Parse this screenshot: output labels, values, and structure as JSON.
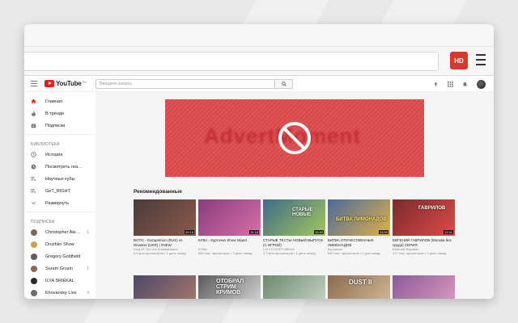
{
  "browser": {
    "url": "",
    "extension_label": "HD"
  },
  "youtube": {
    "logo": "YouTube",
    "logo_region": "RU",
    "search_placeholder": "Введите запрос",
    "sidebar": {
      "main_items": [
        {
          "label": "Главная",
          "icon": "home-icon",
          "active": true
        },
        {
          "label": "В тренде",
          "icon": "fire-icon"
        },
        {
          "label": "Подписки",
          "icon": "subscriptions-icon"
        }
      ],
      "library_header": "БИБЛИОТЕКА",
      "library_items": [
        {
          "label": "История",
          "icon": "history-icon"
        },
        {
          "label": "Посмотреть поз…",
          "icon": "watch-later-icon"
        },
        {
          "label": "Научные кубы",
          "icon": "playlist-icon"
        },
        {
          "label": "GeT_RIGHT",
          "icon": "playlist-icon"
        },
        {
          "label": "Развернуть",
          "icon": "chevron-down-icon"
        }
      ],
      "subs_header": "ПОДПИСКИ",
      "subscriptions": [
        {
          "label": "Christopher Ale…",
          "count": "1",
          "color": "#7a6a5c"
        },
        {
          "label": "Druzhko Show",
          "count": "",
          "color": "#c9a24a"
        },
        {
          "label": "Gregory Goldheld",
          "count": "",
          "color": "#5f5f5f"
        },
        {
          "label": "Suram Gruzin",
          "count": "1",
          "color": "#8b6a4f"
        },
        {
          "label": "ILYA SRIEKAL",
          "count": "",
          "color": "#2a2a2a"
        },
        {
          "label": "Khovansky Live",
          "count": "4",
          "color": "#6e6e6e"
        }
      ]
    },
    "banner": {
      "text": "AdvertMoment",
      "color": "#d9484a"
    },
    "section_title": "Рекомендованные",
    "videos_row1": [
      {
        "title": "BOTO - Gazapstrion (RUS) vs Disaster (UKR) | #NEW",
        "channel": "King Of The Dot Entertainment",
        "meta": "6,6 млн просмотров • 1 день назад",
        "duration": "20:15",
        "overlay": "",
        "c1": "#4a3b3b",
        "c2": "#8b5a4a"
      },
      {
        "title": "КУБА - Курточка Show Island",
        "channel": "KYBA",
        "meta": "650 тыс. просмотров • 1 день назад",
        "duration": "11:18",
        "overlay": "",
        "c1": "#8a3c7c",
        "c2": "#d66fa8"
      },
      {
        "title": "СТАРЫЕ ТЕСТЫ НОВЫЙ ВЫПУСК (С ИГРОЙ)",
        "channel": "СО СО SHOT MEDIA",
        "meta": "1,3 млн просмотров • 1 день назад",
        "duration": "10:42",
        "overlay": "СТАРЫЕ НОВЫЕ",
        "c1": "#3d6b8a",
        "c2": "#a3c85a"
      },
      {
        "title": "БИТВА ОТЕЧЕСТВЕННЫХ ЛИМОНАДОВ",
        "channel": "Куплинов",
        "meta": "890 тыс. просмотров • 2 дня назад",
        "duration": "13:34",
        "overlay": "БИТВА ЛИМОНАДОВ",
        "c1": "#4a6a9a",
        "c2": "#e0b04a"
      },
      {
        "title": "ЕВГЕНИЙ ГАВРИЛОВ (Москва без пруда) СЕРИЯ",
        "channel": "Евгений Жукович",
        "meta": "477 тыс. просмотров • 1 день назад",
        "duration": "22:11",
        "overlay": "ГАВРИЛОВ",
        "c1": "#7a2a2a",
        "c2": "#e04a4a"
      }
    ],
    "videos_row2": [
      {
        "overlay": "",
        "c1": "#4a4a6a",
        "c2": "#b07a6a"
      },
      {
        "overlay": "ОТОБРАЛ СТРИМ КРИМОВ",
        "c1": "#5a5a5a",
        "c2": "#e0e0e0"
      },
      {
        "overlay": "",
        "c1": "#6a8a6a",
        "c2": "#cfd8cf"
      },
      {
        "overlay": "DUST II",
        "c1": "#8a6a4a",
        "c2": "#d9c0a0"
      },
      {
        "overlay": "",
        "c1": "#8a5a9a",
        "c2": "#e0a0c0"
      }
    ]
  }
}
